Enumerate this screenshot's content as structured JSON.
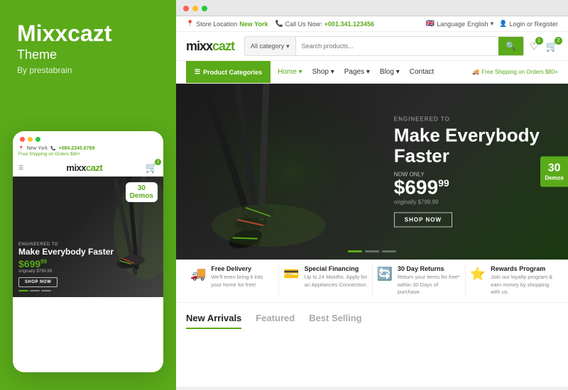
{
  "brand": {
    "title": "Mixxcazt",
    "subtitle": "Theme",
    "by": "By prestabrain"
  },
  "mobile": {
    "dots": [
      "red",
      "yellow",
      "green"
    ],
    "topbar": {
      "location": "New York",
      "phone": "+084.2345.6789",
      "shipping": "Free Shipping on Orders $80+"
    },
    "logo": "mixxcazt",
    "hero": {
      "engineered": "ENGINEERED TO",
      "headline": "Make Everybody Faster",
      "price_label": "NOW ONLY",
      "price": "$699",
      "cents": "99",
      "original": "originally $799.99",
      "shop_btn": "SHOP NOW"
    },
    "badge": {
      "number": "30",
      "label": "Demos"
    }
  },
  "desktop": {
    "topbar": {
      "store_label": "Store Location",
      "store_value": "New York",
      "call_label": "Call Us Now:",
      "call_value": "+001.341.123456",
      "language_label": "Language",
      "language_value": "English",
      "login": "Login or Register"
    },
    "header": {
      "logo": "mixxcazt",
      "search_category": "All category",
      "search_placeholder": "Search products...",
      "wishlist_count": "1",
      "cart_count": "2"
    },
    "nav": {
      "product_categories": "Product Categories",
      "links": [
        "Home",
        "Shop",
        "Pages",
        "Blog",
        "Contact"
      ],
      "active": "Home",
      "shipping_note": "Free Shipping on Orders $80+"
    },
    "hero": {
      "engineered": "ENGINEERED TO",
      "headline_line1": "Make Everybody",
      "headline_line2": "Faster",
      "price_label": "NOW ONLY",
      "price": "$699",
      "cents": "99",
      "original": "originally $799.99",
      "shop_btn": "SHOP NOW",
      "badge_number": "30",
      "badge_label": "Demos"
    },
    "features": [
      {
        "icon": "🚚",
        "title": "Free Delivery",
        "desc": "We'll even bring it into your home for free!"
      },
      {
        "icon": "💳",
        "title": "Special Financing",
        "desc": "Up to 24 Months. Apply for an Appliances Connection."
      },
      {
        "icon": "🔄",
        "title": "30 Day Returns",
        "desc": "Return your items for free* within 30 Days of purchase."
      },
      {
        "icon": "⭐",
        "title": "Rewards Program",
        "desc": "Join our loyalty program & earn money by shopping with us."
      }
    ],
    "tabs": [
      {
        "label": "New Arrivals",
        "active": true
      },
      {
        "label": "Featured",
        "active": false
      },
      {
        "label": "Best Selling",
        "active": false
      }
    ]
  }
}
